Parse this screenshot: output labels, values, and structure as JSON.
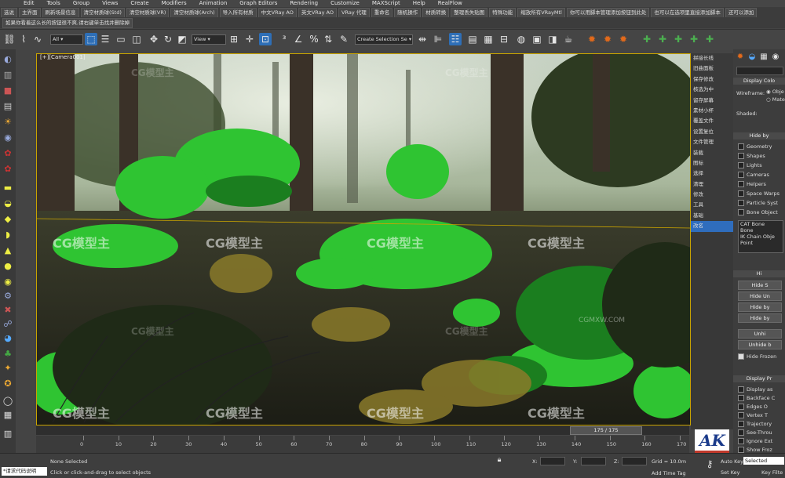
{
  "menu": [
    "Edit",
    "Tools",
    "Group",
    "Views",
    "Create",
    "Modifiers",
    "Animation",
    "Graph Editors",
    "Rendering",
    "Customize",
    "MAXScript",
    "Help",
    "RealFlow"
  ],
  "plugin_row1": [
    "选说",
    "主界面",
    "刷新场景信息",
    "清空材质球(Std)",
    "清空材质球(VR)",
    "清空材质球(Arch)",
    "导入所有材质",
    "中文VRay AO",
    "英文VRay AO",
    "VRay 代理",
    "重命名",
    "随机操作",
    "材质转换",
    "整理丢失贴图",
    "特殊功能",
    "缩放所有VRayMtl",
    "你可以用脚本管理添加按钮到此处",
    "也可以在选项里直接添加脚本",
    "还可以添加"
  ],
  "plugin_row2": [
    "如果你看着这么长的按钮很不爽,请右键单击找并删除掉"
  ],
  "toolbar": {
    "filter_value": "All",
    "view_value": "View",
    "selection_set_placeholder": "Create Selection Se"
  },
  "viewport": {
    "label": "[+][Camera001]",
    "watermarks": [
      "CG模型主",
      "CG模型主",
      "CG模型主",
      "CG模型主",
      "CG模型主",
      "CG模型主",
      "CG模型主",
      "CG模型主",
      "CG模型主",
      "CG模型主",
      "CG模型主",
      "CG模型主"
    ],
    "ribbon_text": "CGMXW.COM"
  },
  "cn_panel": [
    "拼接长线",
    "旧曲面板",
    "保存修改",
    "核选为中",
    "留存屏幕",
    "素材小杯",
    "覆盖文件",
    "设置复位",
    "文件管理",
    "装载",
    "图标",
    "选择",
    "清理",
    "修改",
    "工具",
    "基础",
    "改名"
  ],
  "command_panel": {
    "rollout_display_color": "Display Colo",
    "wireframe_label": "Wireframe:",
    "wireframe_options": [
      "Obje",
      "Mate"
    ],
    "shaded_label": "Shaded:",
    "rollout_hide_by_category": "Hide by",
    "categories": [
      "Geometry",
      "Shapes",
      "Lights",
      "Cameras",
      "Helpers",
      "Space Warps",
      "Particle Syst",
      "Bone Object"
    ],
    "list_items": [
      "CAT Bone",
      "Bone",
      "IK Chain Obje",
      "Point"
    ],
    "rollout_hide": "Hi",
    "hide_buttons": [
      "Hide S",
      "Hide Un",
      "Hide by",
      "Hide by",
      "Unhi",
      "Unhide b"
    ],
    "hide_frozen": "Hide Frozen",
    "rollout_display_props": "Display Pr",
    "display_props": [
      "Display as",
      "Backface C",
      "Edges O",
      "Vertex T",
      "Trajectory",
      "See-Throu",
      "Ignore Ext",
      "Show Froz"
    ]
  },
  "timeslider": {
    "value": "175 / 175"
  },
  "trackbar": {
    "ticks": [
      "0",
      "10",
      "20",
      "30",
      "40",
      "50",
      "60",
      "70",
      "80",
      "90",
      "100",
      "110",
      "120",
      "130",
      "140",
      "150",
      "160",
      "170"
    ]
  },
  "status": {
    "script_label": "*请求代码说明",
    "none_selected": "None Selected",
    "prompt": "Click or click-and-drag to select objects",
    "x_label": "X:",
    "y_label": "Y:",
    "z_label": "Z:",
    "grid": "Grid = 10.0m",
    "add_time_tag": "Add Time Tag",
    "auto_key": "Auto Key",
    "selected": "Selected",
    "set_key": "Set Key",
    "key_filters": "Key Filte"
  },
  "logo": {
    "text": "AK"
  }
}
